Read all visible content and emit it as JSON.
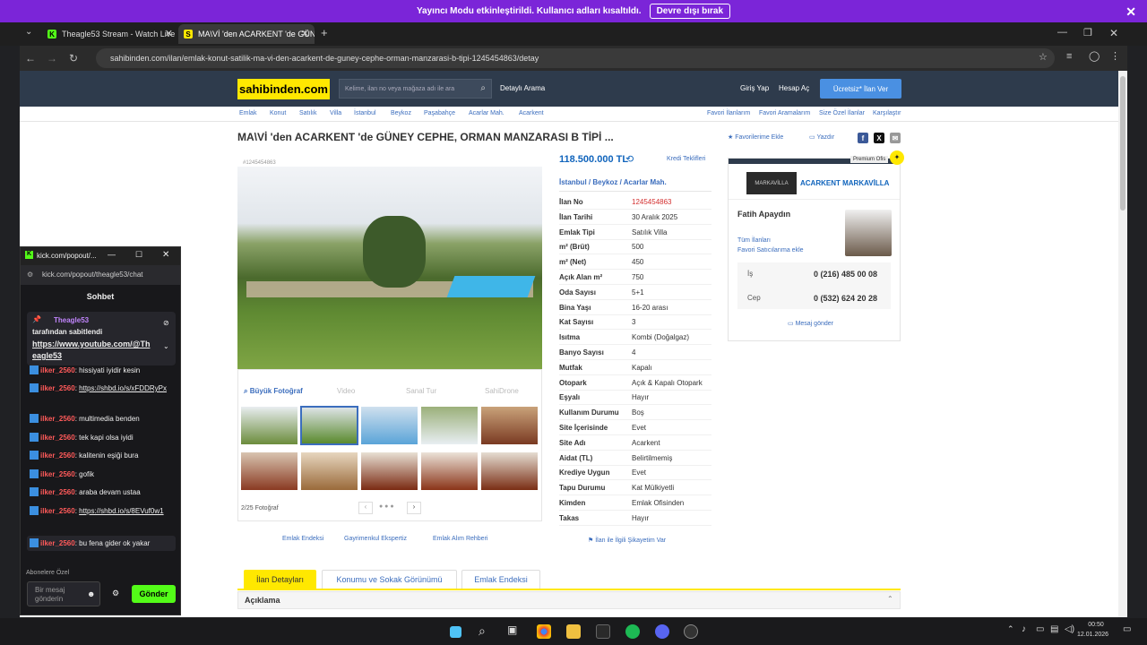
{
  "streamer_bar": {
    "text": "Yayıncı Modu etkinleştirildi. Kullanıcı adları kısaltıldı.",
    "button": "Devre dışı bırak"
  },
  "tabs": [
    {
      "title": "Theagle53 Stream - Watch Live"
    },
    {
      "title": "MA\\Vİ 'den ACARKENT 'de GÜNEY CEPHE"
    }
  ],
  "url": "sahibinden.com/ilan/emlak-konut-satilik-ma-vi-den-acarkent-de-guney-cephe-orman-manzarasi-b-tipi-1245454863/detay",
  "site": {
    "logo": "sahibinden.com",
    "search_placeholder": "Kelime, ilan no veya mağaza adı ile ara",
    "detailed_search": "Detaylı Arama",
    "login": "Giriş Yap",
    "register": "Hesap Aç",
    "post_ad": "Ücretsiz* İlan Ver"
  },
  "breadcrumbs": [
    "Emlak",
    "Konut",
    "Satılık",
    "Villa",
    "İstanbul",
    "Beykoz",
    "Paşabahçe",
    "Acarlar Mah.",
    "Acarkent"
  ],
  "right_links": [
    "Favori İlanlarım",
    "Favori Aramalarım",
    "Size Özel İlanlar",
    "Karşılaştır"
  ],
  "listing": {
    "title": "MA\\Vİ 'den ACARKENT 'de GÜNEY CEPHE, ORMAN MANZARASI B TİPİ ...",
    "id_small": "#1245454863",
    "price": "118.500.000 TL",
    "credit": "Kredi Teklifleri",
    "location": "İstanbul  /  Beykoz  /  Acarlar Mah.",
    "fav": "Favorilerime Ekle",
    "print": "Yazdır",
    "photo_count": "2/25 Fotoğraf",
    "photo_tabs": [
      "Büyük Fotoğraf",
      "Video",
      "Sanal Tur",
      "SahiDrone"
    ],
    "details": [
      [
        "İlan No",
        "1245454863"
      ],
      [
        "İlan Tarihi",
        "30 Aralık 2025"
      ],
      [
        "Emlak Tipi",
        "Satılık Villa"
      ],
      [
        "m² (Brüt)",
        "500"
      ],
      [
        "m² (Net)",
        "450"
      ],
      [
        "Açık Alan m²",
        "750"
      ],
      [
        "Oda Sayısı",
        "5+1"
      ],
      [
        "Bina Yaşı",
        "16-20 arası"
      ],
      [
        "Kat Sayısı",
        "3"
      ],
      [
        "Isıtma",
        "Kombi (Doğalgaz)"
      ],
      [
        "Banyo Sayısı",
        "4"
      ],
      [
        "Mutfak",
        "Kapalı"
      ],
      [
        "Otopark",
        "Açık & Kapalı Otopark"
      ],
      [
        "Eşyalı",
        "Hayır"
      ],
      [
        "Kullanım Durumu",
        "Boş"
      ],
      [
        "Site İçerisinde",
        "Evet"
      ],
      [
        "Site Adı",
        "Acarkent"
      ],
      [
        "Aidat (TL)",
        "Belirtilmemiş"
      ],
      [
        "Krediye Uygun",
        "Evet"
      ],
      [
        "Tapu Durumu",
        "Kat Mülkiyetli"
      ],
      [
        "Kimden",
        "Emlak Ofisinden"
      ],
      [
        "Takas",
        "Hayır"
      ]
    ]
  },
  "agent": {
    "premium": "Premium Ofis",
    "office": "ACARKENT MARKAVİLLA",
    "logo_text": "MARKAVİLLA",
    "name": "Fatih Apaydın",
    "all_ads": "Tüm İlanları",
    "fav_seller": "Favori Satıcılarıma ekle",
    "work_label": "İş",
    "work_phone": "0 (216) 485 00 08",
    "cell_label": "Cep",
    "cell_phone": "0 (532) 624 20 28",
    "message": "Mesaj gönder"
  },
  "bottom_links": [
    "Emlak Endeksi",
    "Gayrimenkul Ekspertiz",
    "Emlak Alım Rehberi"
  ],
  "complaint": "İlan ile İlgili Şikayetim Var",
  "page_tabs": [
    "İlan Detayları",
    "Konumu ve Sokak Görünümü",
    "Emlak Endeksi"
  ],
  "section_title": "Açıklama",
  "chat": {
    "window_title": "kick.com/popout/...",
    "url": "kick.com/popout/theagle53/chat",
    "header": "Sohbet",
    "pinned_user": "Theagle53",
    "pinned_by": "tarafından sabitlendi",
    "pinned_link": "https://www.youtube.com/@Theagle53",
    "messages": [
      {
        "user": "ilker_2560",
        "text": "hissiyati iyidir kesin"
      },
      {
        "user": "ilker_2560",
        "text": "https://shbd.io/s/xFDDRyPx"
      },
      {
        "user": "ilker_2560",
        "text": "multimedia benden"
      },
      {
        "user": "ilker_2560",
        "text": "tek kapi olsa iyidi"
      },
      {
        "user": "ilker_2560",
        "text": "kalitenin eşiği bura"
      },
      {
        "user": "ilker_2560",
        "text": "gofik"
      },
      {
        "user": "ilker_2560",
        "text": "araba devam ustaa"
      },
      {
        "user": "ilker_2560",
        "text": "https://shbd.io/s/8EVuf0w1"
      },
      {
        "user": "ilker_2560",
        "text": "bu fena gider ok yakar"
      }
    ],
    "subscribers": "Abonelere Özel",
    "input_placeholder": "Bir mesaj gönderin",
    "send": "Gönder"
  },
  "clock": {
    "time": "00:50",
    "date": "12.01.2026"
  }
}
